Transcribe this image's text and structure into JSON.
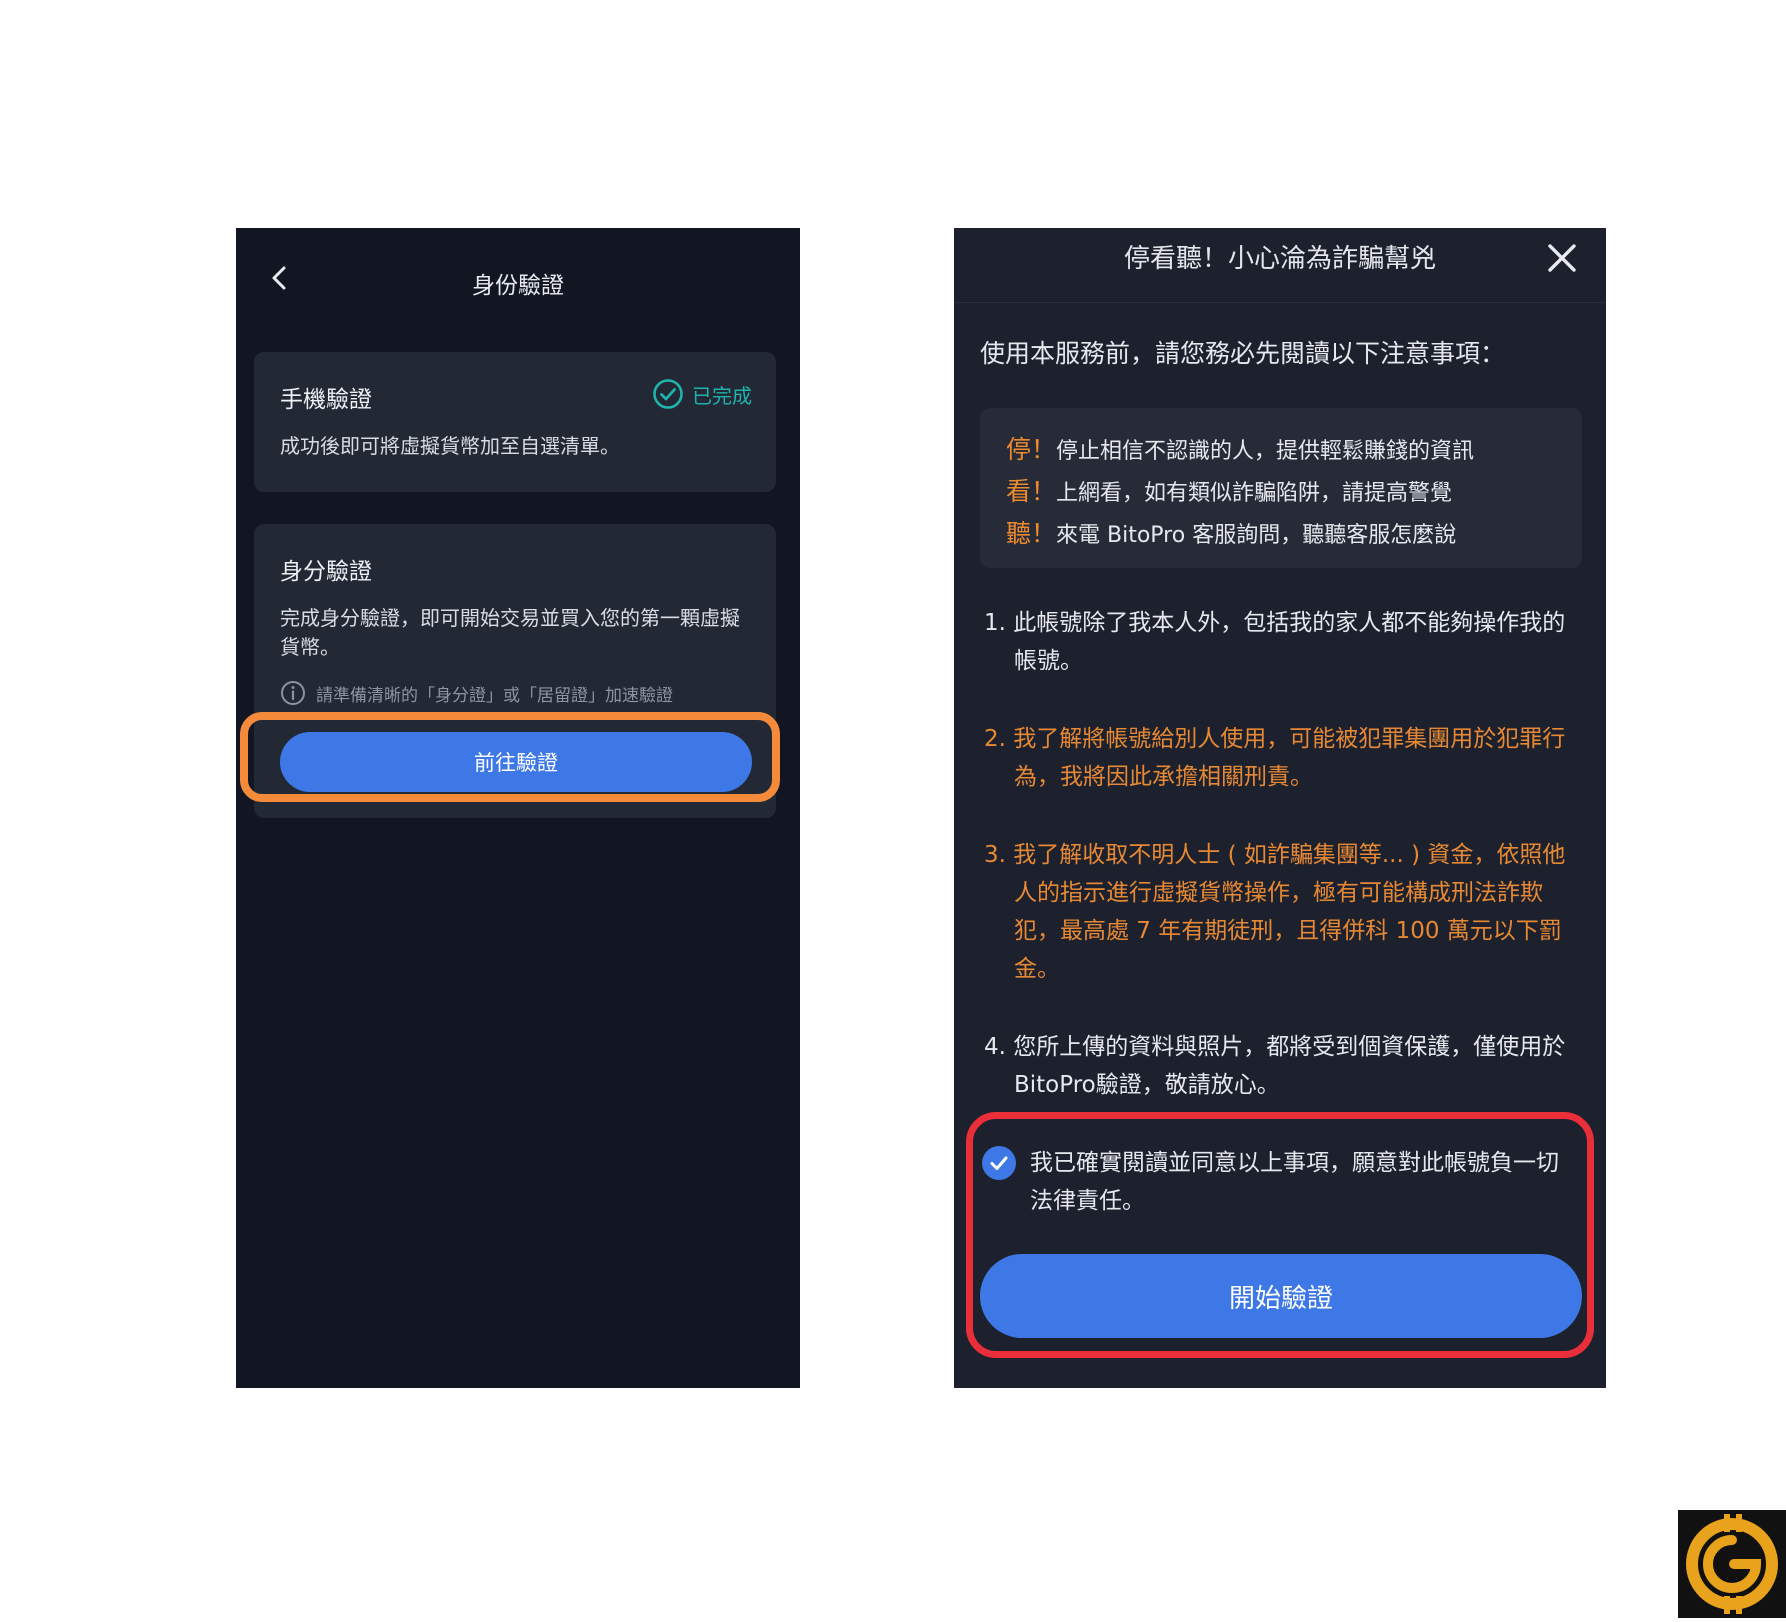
{
  "left_screen": {
    "nav_title": "身份驗證",
    "phone_card": {
      "title": "手機驗證",
      "status": "已完成",
      "description": "成功後即可將虛擬貨幣加至自選清單。"
    },
    "id_card": {
      "title": "身分驗證",
      "description": "完成身分驗證，即可開始交易並買入您的第一顆虛擬貨幣。",
      "hint": "請準備清晰的「身分證」或「居留證」加速驗證",
      "button_label": "前往驗證"
    }
  },
  "right_screen": {
    "modal_title": "停看聽！小心淪為詐騙幫兇",
    "intro": "使用本服務前，請您務必先閱讀以下注意事項：",
    "warnings": [
      {
        "key": "停！",
        "text": "停止相信不認識的人，提供輕鬆賺錢的資訊"
      },
      {
        "key": "看！",
        "text": "上網看，如有類似詐騙陷阱，請提高警覺"
      },
      {
        "key": "聽！",
        "text": "來電 BitoPro 客服詢問，聽聽客服怎麼說"
      }
    ],
    "terms": [
      "1. 此帳號除了我本人外，包括我的家人都不能夠操作我的帳號。",
      "2. 我了解將帳號給別人使用，可能被犯罪集團用於犯罪行為，我將因此承擔相關刑責。",
      "3. 我了解收取不明人士 ( 如詐騙集團等... ) 資金，依照他人的指示進行虛擬貨幣操作，極有可能構成刑法詐欺犯，最高處 7 年有期徒刑，且得併科 100 萬元以下罰金。",
      "4. 您所上傳的資料與照片，都將受到個資保護，僅使用於BitoPro驗證，敬請放心。"
    ],
    "agree_text": "我已確實閱讀並同意以上事項，願意對此帳號負一切法律責任。",
    "agree_checked": true,
    "button_label": "開始驗證"
  },
  "colors": {
    "panel_bg": "#121622",
    "card_bg": "#232835",
    "accent_blue": "#3d78e6",
    "success_teal": "#1fb3ad",
    "warning_orange": "#e78934",
    "highlight_orange": "#f58b3a",
    "highlight_red": "#ea2f3a"
  },
  "icons": {
    "back": "chevron-left-icon",
    "done": "check-circle-icon",
    "info": "info-circle-icon",
    "close": "close-icon",
    "checkbox": "checkmark-icon"
  }
}
